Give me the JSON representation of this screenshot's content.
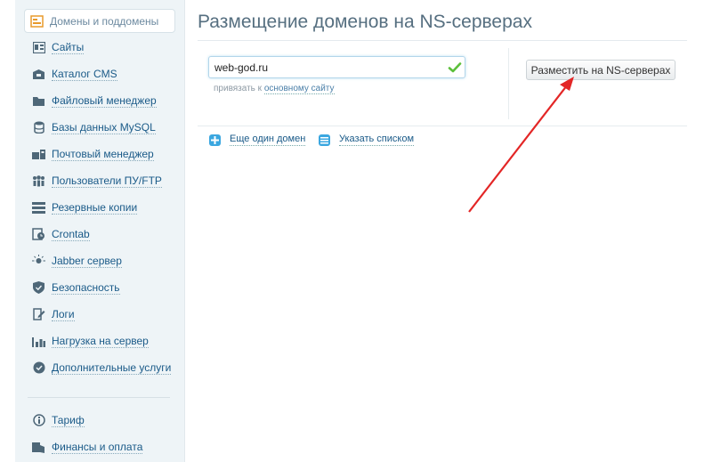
{
  "sidebar": {
    "items": [
      {
        "label": "Домены и поддомены",
        "icon": "domains-icon",
        "active": true
      },
      {
        "label": "Сайты",
        "icon": "sites-icon"
      },
      {
        "label": "Каталог CMS",
        "icon": "cms-icon"
      },
      {
        "label": "Файловый менеджер",
        "icon": "folder-icon"
      },
      {
        "label": "Базы данных MySQL",
        "icon": "database-icon"
      },
      {
        "label": "Почтовый менеджер",
        "icon": "mail-icon"
      },
      {
        "label": "Пользователи ПУ/FTP",
        "icon": "users-icon"
      },
      {
        "label": "Резервные копии",
        "icon": "backup-icon"
      },
      {
        "label": "Crontab",
        "icon": "clock-icon"
      },
      {
        "label": "Jabber сервер",
        "icon": "bulb-icon"
      },
      {
        "label": "Безопасность",
        "icon": "shield-icon"
      },
      {
        "label": "Логи",
        "icon": "logs-icon"
      },
      {
        "label": "Нагрузка на сервер",
        "icon": "load-chart-icon"
      },
      {
        "label": "Дополнительные услуги",
        "icon": "services-gear-icon"
      }
    ],
    "bottom_items": [
      {
        "label": "Тариф",
        "icon": "tariff-icon"
      },
      {
        "label": "Финансы и оплата",
        "icon": "finance-icon"
      }
    ]
  },
  "main": {
    "title": "Размещение доменов на NS-серверах",
    "domain_input": {
      "value": "web-god.ru",
      "placeholder": ""
    },
    "hint": {
      "prefix": "привязать к",
      "link": "основному сайту"
    },
    "submit_button": "Разместить на NS-серверах",
    "actions": {
      "add_domain": "Еще один домен",
      "list_mode": "Указать списком"
    }
  },
  "colors": {
    "accent": "#3ba7e0",
    "link": "#1a5a88",
    "sidebar_bg": "#eef4f7",
    "arrow": "#e32626",
    "check": "#5bbf3a"
  }
}
